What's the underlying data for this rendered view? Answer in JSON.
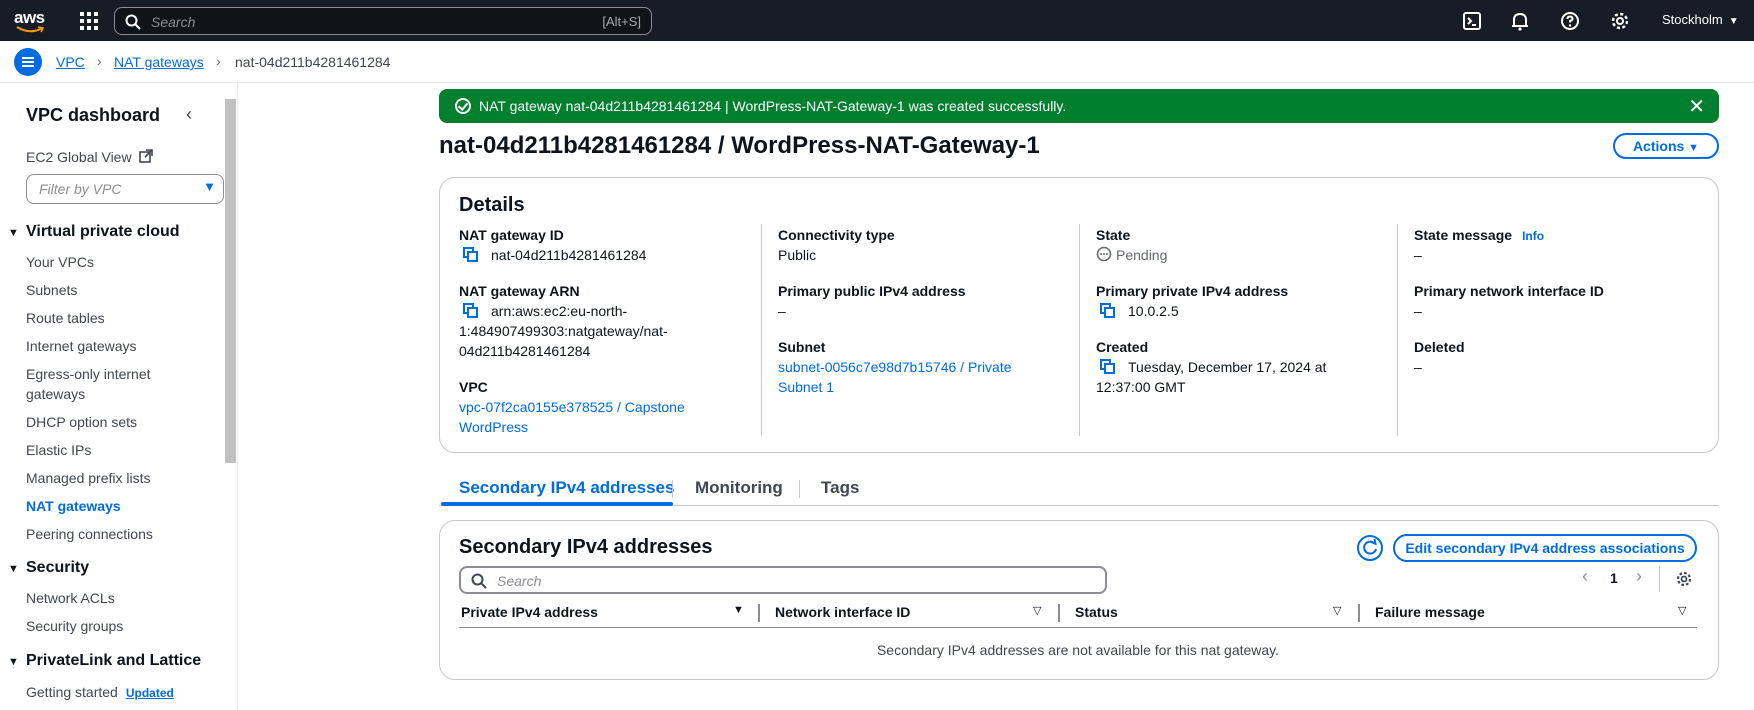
{
  "topnav": {
    "logo": "aws",
    "search_placeholder": "Search",
    "search_shortcut": "[Alt+S]",
    "region": "Stockholm",
    "icons": [
      "cloudshell-icon",
      "bell-icon",
      "help-icon",
      "gear-icon"
    ]
  },
  "breadcrumb": {
    "items": [
      {
        "label": "VPC"
      },
      {
        "label": "NAT gateways"
      },
      {
        "label": "nat-04d211b4281461284"
      }
    ]
  },
  "sidebar": {
    "title": "VPC dashboard",
    "ec2_global_view": "EC2 Global View",
    "filter_placeholder": "Filter by VPC",
    "sections": [
      {
        "title": "Virtual private cloud",
        "items": [
          "Your VPCs",
          "Subnets",
          "Route tables",
          "Internet gateways",
          "Egress-only internet gateways",
          "DHCP option sets",
          "Elastic IPs",
          "Managed prefix lists",
          "NAT gateways",
          "Peering connections"
        ]
      },
      {
        "title": "Security",
        "items": [
          "Network ACLs",
          "Security groups"
        ]
      },
      {
        "title": "PrivateLink and Lattice",
        "items": [
          "Getting started"
        ]
      }
    ],
    "active_item": "NAT gateways",
    "updated_badge": "Updated"
  },
  "flash": {
    "message": "NAT gateway nat-04d211b4281461284 | WordPress-NAT-Gateway-1 was created successfully."
  },
  "page": {
    "title": "nat-04d211b4281461284 / WordPress-NAT-Gateway-1",
    "actions_label": "Actions"
  },
  "details": {
    "heading": "Details",
    "nat_gateway_id": {
      "label": "NAT gateway ID",
      "value": "nat-04d211b4281461284"
    },
    "nat_gateway_arn": {
      "label": "NAT gateway ARN",
      "lines": [
        "arn:aws:ec2:eu-north-",
        "1:484907499303:natgateway/nat-",
        "04d211b4281461284"
      ]
    },
    "vpc": {
      "label": "VPC",
      "lines": [
        "vpc-07f2ca0155e378525 / Capstone",
        "WordPress"
      ]
    },
    "connectivity_type": {
      "label": "Connectivity type",
      "value": "Public"
    },
    "primary_public_ipv4": {
      "label": "Primary public IPv4 address",
      "value": "–"
    },
    "subnet": {
      "label": "Subnet",
      "lines": [
        "subnet-0056c7e98d7b15746 / Private",
        "Subnet 1"
      ]
    },
    "state": {
      "label": "State",
      "value": "Pending"
    },
    "primary_private_ipv4": {
      "label": "Primary private IPv4 address",
      "value": "10.0.2.5"
    },
    "created": {
      "label": "Created",
      "lines": [
        "Tuesday, December 17, 2024 at",
        "12:37:00 GMT"
      ]
    },
    "state_message": {
      "label": "State message",
      "info": "Info",
      "value": "–"
    },
    "primary_network_interface_id": {
      "label": "Primary network interface ID",
      "value": "–"
    },
    "deleted": {
      "label": "Deleted",
      "value": "–"
    }
  },
  "tabs": [
    {
      "label": "Secondary IPv4 addresses",
      "active": true
    },
    {
      "label": "Monitoring",
      "active": false
    },
    {
      "label": "Tags",
      "active": false
    }
  ],
  "secondary": {
    "heading": "Secondary IPv4 addresses",
    "edit_button": "Edit secondary IPv4 address associations",
    "search_placeholder": "Search",
    "page_number": "1",
    "columns": [
      "Private IPv4 address",
      "Network interface ID",
      "Status",
      "Failure message"
    ],
    "empty_message": "Secondary IPv4 addresses are not available for this nat gateway."
  },
  "colors": {
    "accent": "#006ce0",
    "success": "#00802f",
    "topnav_bg": "#161d26"
  }
}
